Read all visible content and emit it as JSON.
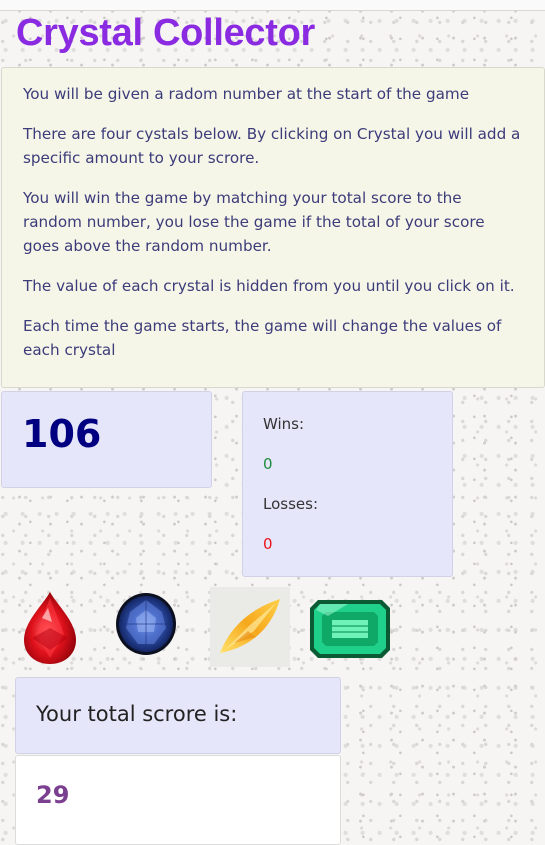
{
  "app": {
    "title": "Crystal Collector"
  },
  "instructions": [
    "You will be given a radom number at the start of the game",
    "There are four cystals below. By clicking on Crystal you will add a specific amount to your scrore.",
    "You will win the game by matching your total score to the random number, you lose the game if the total of your score goes above the random number.",
    "The value of each crystal is hidden from you until you click on it.",
    "Each time the game starts, the game will change the values of each crystal"
  ],
  "target_number": "106",
  "stats": {
    "wins_label": "Wins:",
    "wins": "0",
    "losses_label": "Losses:",
    "losses": "0"
  },
  "crystals": [
    {
      "name": "red-pear-crystal",
      "color": "#d8121f"
    },
    {
      "name": "blue-round-crystal",
      "color": "#2b4ea8"
    },
    {
      "name": "yellow-marquise-crystal",
      "color": "#f4b424"
    },
    {
      "name": "green-emerald-crystal",
      "color": "#16c77a"
    }
  ],
  "score": {
    "label": "Your total scrore is:",
    "value": "29"
  },
  "colors": {
    "title": "#8a2be2",
    "target": "#000080",
    "wins": "#1e8a3c",
    "losses": "#e8141e",
    "panel": "#e6e6fa",
    "instructions_bg": "#f5f5e8"
  }
}
